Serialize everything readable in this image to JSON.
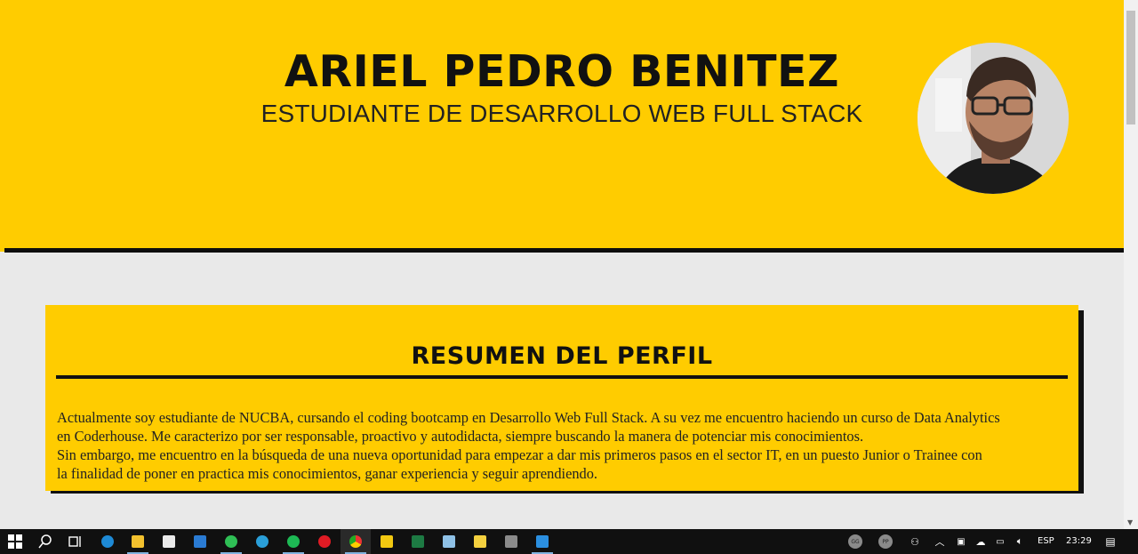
{
  "header": {
    "name": "ARIEL PEDRO BENITEZ",
    "subtitle": "ESTUDIANTE DE DESARROLLO WEB FULL STACK"
  },
  "profile": {
    "title": "RESUMEN DEL PERFIL",
    "line1": "Actualmente soy estudiante de NUCBA, cursando el coding bootcamp en Desarrollo Web Full Stack. A su vez me encuentro haciendo un curso de Data Analytics",
    "line2": "en Coderhouse. Me caracterizo por ser responsable, proactivo y autodidacta, siempre buscando la manera de potenciar mis conocimientos.",
    "line3": "Sin embargo, me encuentro en la búsqueda de una nueva oportunidad para empezar a dar mis primeros pasos en el sector IT, en un puesto Junior o Trainee con",
    "line4": "la finalidad de poner en practica mis conocimientos, ganar experiencia y seguir aprendiendo."
  },
  "taskbar": {
    "apps": [
      "windows-start-icon",
      "search-icon",
      "task-view-icon",
      "edge-icon",
      "file-explorer-icon",
      "store-icon",
      "mail-icon",
      "whatsapp-icon",
      "telegram-icon",
      "spotify-icon",
      "opera-icon",
      "chrome-icon",
      "power-bi-icon",
      "excel-icon",
      "notepad-icon",
      "sticky-notes-icon",
      "calculator-icon",
      "vscode-icon"
    ],
    "tray": {
      "avatar1": "GG",
      "avatar2": "PP",
      "language": "ESP",
      "time": "23:29"
    }
  },
  "colors": {
    "accent": "#ffcc00",
    "background": "#e9e9e9",
    "text": "#111111"
  }
}
